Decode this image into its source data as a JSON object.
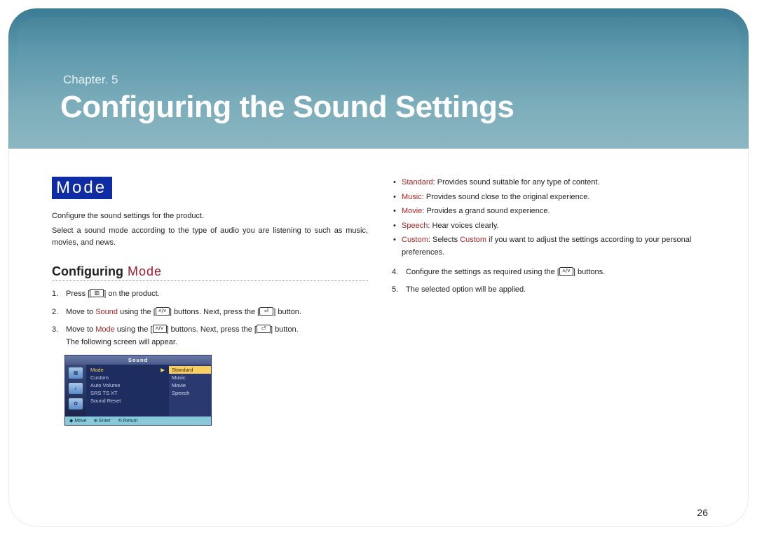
{
  "header": {
    "chapter_label": "Chapter. 5",
    "title": "Configuring the Sound Settings"
  },
  "section": {
    "badge": "Mode",
    "intro1": "Configure the sound settings for the product.",
    "intro2": "Select a sound mode according to the type of audio you are listening to such as music, movies, and news."
  },
  "subheading": {
    "a": "Configuring",
    "b": "Mode"
  },
  "steps": {
    "s1_a": "Press [",
    "s1_b": "] on the product.",
    "s2_a": "Move to ",
    "s2_kw": "Sound",
    "s2_b": " using the [",
    "s2_c": "] buttons. Next, press the [",
    "s2_d": "] button.",
    "s3_a": "Move to ",
    "s3_kw": "Mode",
    "s3_b": " using the [",
    "s3_c": "] buttons. Next, press the [",
    "s3_d": "] button.",
    "s3_e": "The following screen will appear.",
    "s4_a": "Configure the settings as required using the [",
    "s4_b": "] buttons.",
    "s5": "The selected option will be applied."
  },
  "osd": {
    "title": "Sound",
    "menu": [
      "Mode",
      "Custom",
      "Auto Volume",
      "SRS TS XT",
      "Sound Reset"
    ],
    "submenu": [
      "Standard",
      "Music",
      "Movie",
      "Speech"
    ],
    "footer": [
      "◆ Move",
      "⊕ Enter",
      "⟲ Return"
    ]
  },
  "modes": [
    {
      "name": "Standard",
      "desc": "Provides sound suitable for any type of content."
    },
    {
      "name": "Music",
      "desc": "Provides sound close to the original experience."
    },
    {
      "name": "Movie",
      "desc": "Provides a grand sound experience."
    },
    {
      "name": "Speech",
      "desc": "Hear voices clearly."
    },
    {
      "name": "Custom",
      "desc_a": "Selects ",
      "desc_kw": "Custom",
      "desc_b": " if you want to adjust the settings according to your personal preferences."
    }
  ],
  "icons": {
    "menu_glyph": "▥",
    "updown_glyph": "˄/˅",
    "enter_glyph": "⏎"
  },
  "page_number": "26"
}
